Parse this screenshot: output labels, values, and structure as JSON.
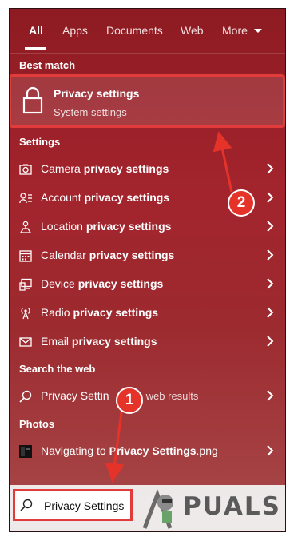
{
  "tabs": [
    {
      "label": "All"
    },
    {
      "label": "Apps"
    },
    {
      "label": "Documents"
    },
    {
      "label": "Web"
    },
    {
      "label": "More"
    }
  ],
  "best_match": {
    "header": "Best match",
    "title": "Privacy settings",
    "subtitle": "System settings",
    "icon": "lock-icon"
  },
  "settings": {
    "header": "Settings",
    "items": [
      {
        "pre": "Camera ",
        "bold": "privacy settings",
        "icon": "camera-icon"
      },
      {
        "pre": "Account ",
        "bold": "privacy settings",
        "icon": "account-list-icon"
      },
      {
        "pre": "Location ",
        "bold": "privacy settings",
        "icon": "location-icon"
      },
      {
        "pre": "Calendar ",
        "bold": "privacy settings",
        "icon": "calendar-icon"
      },
      {
        "pre": "Device ",
        "bold": "privacy settings",
        "icon": "device-icon"
      },
      {
        "pre": "Radio ",
        "bold": "privacy settings",
        "icon": "radio-icon"
      },
      {
        "pre": "Email ",
        "bold": "privacy settings",
        "icon": "email-icon"
      }
    ]
  },
  "web": {
    "header": "Search the web",
    "label": "Privacy Settin",
    "suffix": "ee web results"
  },
  "photos": {
    "header": "Photos",
    "pre": "Navigating to ",
    "bold": "Privacy Settings",
    "ext": ".png"
  },
  "search": {
    "value": "Privacy Settings"
  },
  "annotations": {
    "step1": "1",
    "step2": "2"
  },
  "watermark": "PUALS",
  "colors": {
    "accent_red": "#e5332a",
    "panel_top": "#8e1b22",
    "panel_bottom": "#a84a4a"
  }
}
